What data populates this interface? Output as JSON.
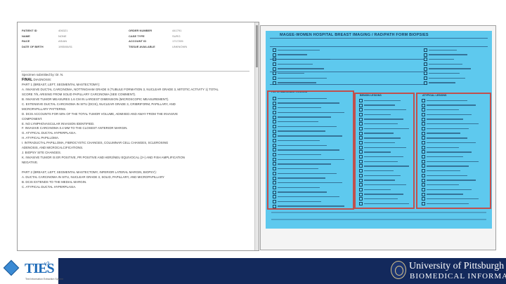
{
  "report": {
    "header_left": [
      {
        "key": "PATIENT ID",
        "value": "406321"
      },
      {
        "key": "NAME",
        "value": "NONE"
      },
      {
        "key": "RACE",
        "value": "ASIAN"
      },
      {
        "key": "DATE OF BIRTH",
        "value": "1955/06/01"
      }
    ],
    "header_right": [
      {
        "key": "ORDER NUMBER",
        "value": "441791"
      },
      {
        "key": "CASE TYPE",
        "value": "SURG"
      },
      {
        "key": "ACCOUNT ID",
        "value": "1717205"
      },
      {
        "key": "TISSUE AVAILABLE",
        "value": "UNKNOWN"
      }
    ],
    "specimen_line": "Specimen submitted by: Dr. N.",
    "final_label": "FINAL",
    "final_suffix": "DIAGNOSIS:",
    "lines": [
      "PART 1 (BREAST, LEFT, SEGMENTAL MASTECTOMY):",
      "A.     INVASIVE DUCTAL CARCINOMA, NOTTINGHAM GRADE II (TUBULE FORMATION 3, NUCLEAR GRADE 3, MITOTIC ACTIVITY 1) TOTAL",
      "SCORE 7/9, ARISING FROM SOLID PAPILLARY CARCINOMA (SEE COMMENT).",
      "B.     INVASIVE TUMOR MEASURES 1.6 CM IN LARGEST DIMENSION (MICROSCOPIC MEASUREMENT).",
      "C.     EXTENSIVE DUCTAL CARCINOMA IN SITU (DCIS), NUCLEAR GRADE 3, CRIBRIFORM, PAPILLARY, AND",
      "MICROPAPILLARY PATTERNS.",
      "D.     DCIS ACCOUNTS FOR 50% OF THE TOTAL TUMOR VOLUME, ADMIXED AND AWAY FROM THE INVASIVE",
      "COMPONENT.",
      "E.     NO LYMPHOVASCULAR INVASION IDENTIFIED.",
      "F.     INVASIVE CARCINOMA 0.4 MM TO THE CLOSEST ANTERIOR MARGIN.",
      "G.     ATYPICAL DUCTAL HYPERPLASIA.",
      "H.     ATYPICAL PAPILLOMA.",
      "I.     INTRADUCTAL PAPILLOMA, FIBROCYSTIC CHANGES, COLUMNAR CELL CHANGES, SCLEROSING",
      "ADENOSIS, AND MICROCALCIFICATIONS.",
      "J.     BIOPSY SITE CHANGES.",
      "K.     INVASIVE TUMOR IS ER POSITIVE, PR POSITIVE AND HER2/NEU EQUIVOCAL (2+) AND FISH AMPLIFICATION",
      "NEGATIVE.",
      "",
      "PART 2 (BREAST, LEFT, SEGMENTAL MASTECTOMY, INFERIOR LATERAL MARGIN, BIOPSY):",
      "A.     DUCTAL CARCINOMA IN SITU, NUCLEAR GRADE 3, SOLID, PAPILLARY, AND MICROPAPILLARY",
      "B.     DCIS EXTENDS TO THE MEDIAL MARGIN.",
      "C.     ATYPICAL DUCTAL HYPERPLASIA."
    ]
  },
  "form": {
    "title": "MAGEE-WOMEN HOSPITAL  BREAST IMAGING / RAD/PATH FORM BIOPSIES",
    "section_labels": [
      "PAT. ID  MALIGNANT LESIONS",
      "BENIGN LESIONS",
      "ATYPICAL LESIONS"
    ]
  },
  "footer": {
    "logo_text": "TIES",
    "logo_sup": "v3",
    "logo_sub": "Text Information Extraction System",
    "uni_line1": "University of Pittsburgh",
    "uni_line2": "BIOMEDICAL INFORMATICS"
  }
}
